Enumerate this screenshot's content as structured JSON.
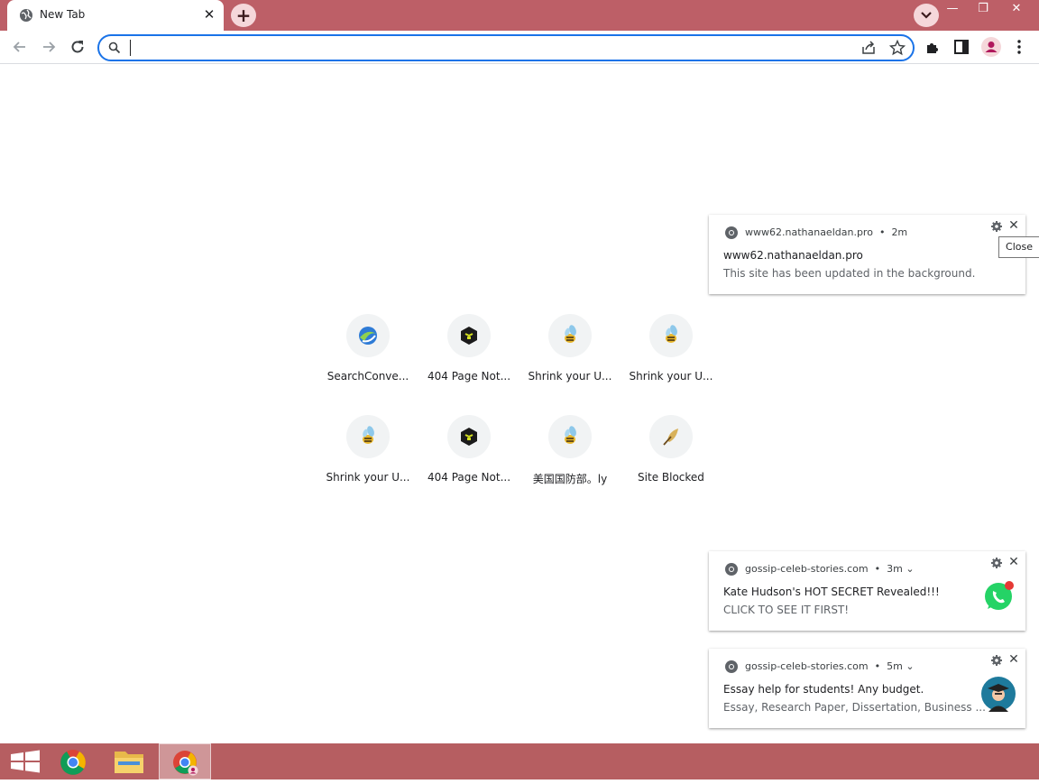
{
  "browser": {
    "tab": {
      "title": "New Tab",
      "close_glyph": "✕"
    },
    "new_tab_glyph": "+",
    "window_controls": {
      "minimize": "—",
      "restore": "❐",
      "close": "✕"
    },
    "omnibox": {
      "value": "",
      "placeholder": ""
    }
  },
  "shortcuts": [
    {
      "label": "SearchConve...",
      "icon": "globe-swirl-icon"
    },
    {
      "label": "404 Page Not...",
      "icon": "black-box-icon"
    },
    {
      "label": "Shrink your U...",
      "icon": "bee-icon"
    },
    {
      "label": "Shrink your U...",
      "icon": "bee-icon"
    },
    {
      "label": "Shrink your U...",
      "icon": "bee-icon"
    },
    {
      "label": "404 Page Not...",
      "icon": "black-box-icon"
    },
    {
      "label": "美国国防部。ly",
      "icon": "bee-icon"
    },
    {
      "label": "Site Blocked",
      "icon": "quill-icon"
    }
  ],
  "notifications": [
    {
      "origin": "www62.nathanaeldan.pro",
      "time": "2m",
      "title": "www62.nathanaeldan.pro",
      "body": "This site has been updated in the background.",
      "tooltip": "Close"
    },
    {
      "origin": "gossip-celeb-stories.com",
      "time": "3m",
      "title": "Kate Hudson's HOT SECRET Revealed!!!",
      "body": "CLICK TO SEE IT FIRST!",
      "thumb": "whatsapp-icon"
    },
    {
      "origin": "gossip-celeb-stories.com",
      "time": "5m",
      "title": "Essay help for students! Any budget.",
      "body": "Essay, Research Paper, Dissertation, Business ...",
      "thumb": "graduate-avatar-icon"
    }
  ],
  "colors": {
    "frame": "#bd5f67",
    "taskbar": "#b65e61",
    "omnibox_focus": "#1a73e8",
    "whatsapp": "#25d366"
  }
}
